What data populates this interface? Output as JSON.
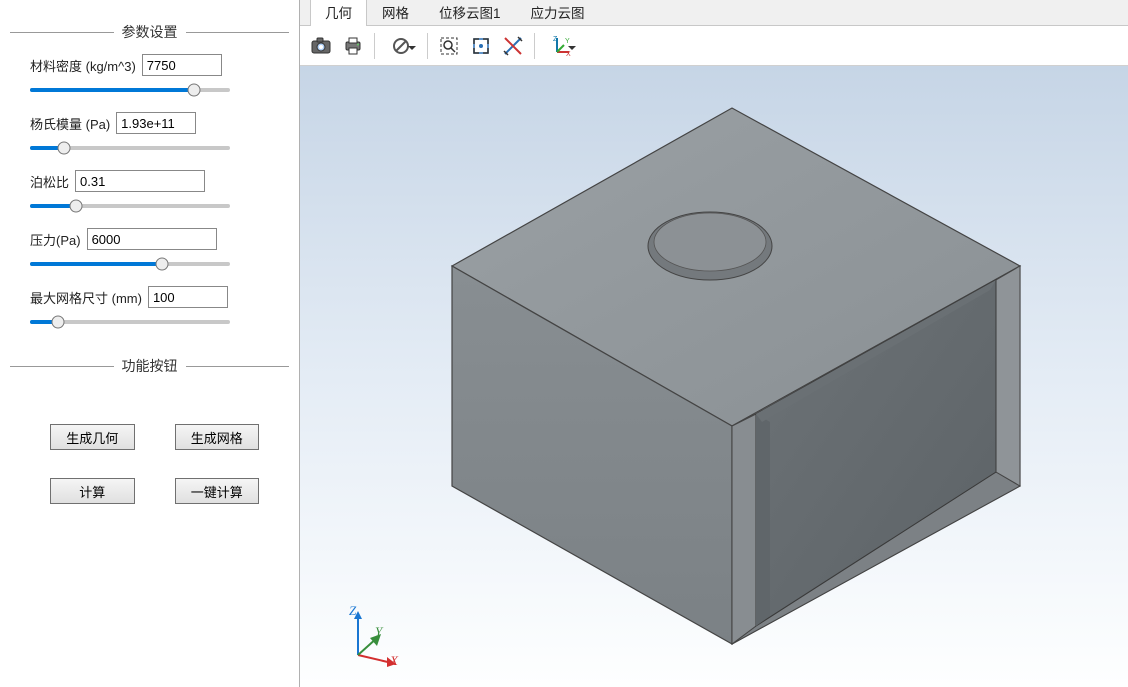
{
  "sidebar": {
    "groups": {
      "params_title": "参数设置",
      "buttons_title": "功能按钮"
    },
    "params": {
      "density": {
        "label": "材料密度 (kg/m^3)",
        "value": "7750",
        "slider_pct": 82
      },
      "youngs": {
        "label": "杨氏模量 (Pa)",
        "value": "1.93e+11",
        "slider_pct": 17
      },
      "poisson": {
        "label": "泊松比",
        "value": "0.31",
        "slider_pct": 23
      },
      "pressure": {
        "label": "压力(Pa)",
        "value": "6000",
        "slider_pct": 66
      },
      "mesh": {
        "label": "最大网格尺寸 (mm)",
        "value": "100",
        "slider_pct": 14
      }
    },
    "buttons": {
      "gen_geom": "生成几何",
      "gen_mesh": "生成网格",
      "compute": "计算",
      "one_click": "一键计算"
    }
  },
  "tabs": {
    "items": [
      "几何",
      "网格",
      "位移云图1",
      "应力云图"
    ],
    "active_index": 0
  },
  "toolbar": {
    "icons": {
      "camera": "camera-icon",
      "print": "print-icon",
      "block": "block-icon",
      "zoom_area": "zoom-area-icon",
      "fit": "fit-icon",
      "measure": "measure-icon",
      "axes": "axes-icon"
    }
  },
  "axes_labels": {
    "x": "X",
    "y": "Y",
    "z": "Z"
  }
}
